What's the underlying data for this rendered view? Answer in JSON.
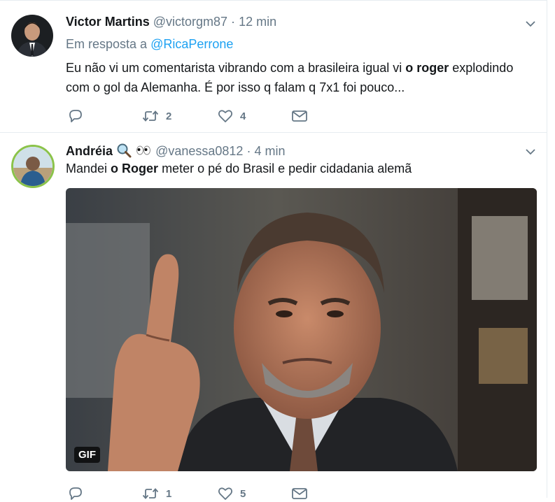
{
  "tweets": [
    {
      "name": "Victor Martins",
      "handle": "@victorgm87",
      "separator": "·",
      "time": "12 min",
      "reply_prefix": "Em resposta a",
      "reply_mention": "@RicaPerrone",
      "text_line1_pre": "Eu não vi um comentarista vibrando com a brasileira igual vi ",
      "text_line1_bold": "o roger",
      "text_line1_post": " explodindo",
      "text_line2": "com o gol da Alemanha. É por isso q falam q 7x1 foi pouco...",
      "retweets": "2",
      "likes": "4",
      "icons": [
        "reply-icon",
        "retweet-icon",
        "like-icon",
        "message-icon",
        "chevron-down-icon"
      ]
    },
    {
      "name": "Andréia",
      "handle": "@vanessa0812",
      "separator": "·",
      "time": "4 min",
      "text_pre": "Mandei ",
      "text_bold": "o Roger",
      "text_post": " meter o pé do Brasil e pedir cidadania alemã",
      "media_badge": "GIF",
      "retweets": "1",
      "likes": "5",
      "icons": [
        "magnifier-icon",
        "eyes-icon",
        "reply-icon",
        "retweet-icon",
        "like-icon",
        "message-icon"
      ]
    }
  ],
  "colors": {
    "link": "#1da1f2",
    "muted": "#657786",
    "text": "#14171a",
    "border": "#e6ecf0"
  }
}
